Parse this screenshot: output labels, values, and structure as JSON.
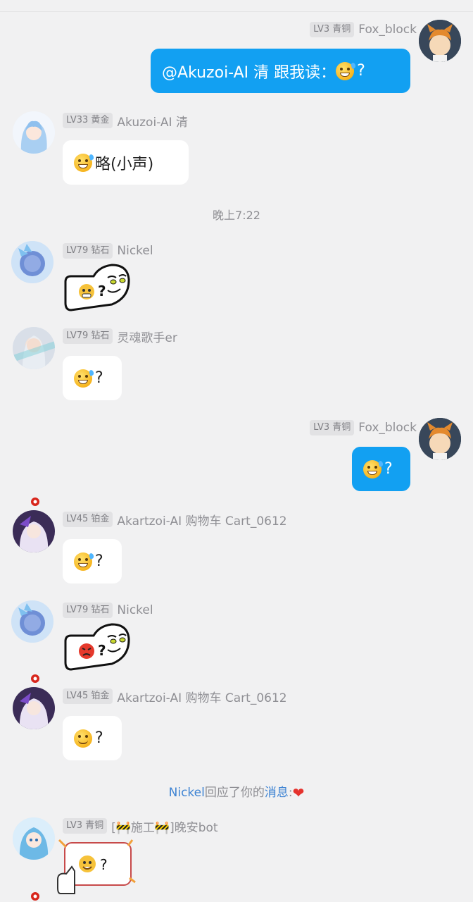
{
  "messages": [
    {
      "id": "m1",
      "side": "right",
      "level": "LV3 青铜",
      "name": "Fox_block",
      "text": "@Akuzoi-AI 清 跟我读：",
      "suffix": "?"
    },
    {
      "id": "m2",
      "side": "left",
      "level": "LV33 黄金",
      "name": "Akuzoi-AI 清",
      "text": "略(小声)"
    },
    {
      "id": "m3",
      "side": "left",
      "level": "LV79 钻石",
      "name": "Nickel",
      "sticker": "ghost-fear-question-sticker"
    },
    {
      "id": "m4",
      "side": "left",
      "level": "LV79 钻石",
      "name": "灵魂歌手er",
      "suffix": "?"
    },
    {
      "id": "m5",
      "side": "right",
      "level": "LV3 青铜",
      "name": "Fox_block",
      "suffix": "?"
    },
    {
      "id": "m6",
      "side": "left",
      "level": "LV45 铂金",
      "name": "Akartzoi-AI 购物车 Cart_0612",
      "suffix": "?"
    },
    {
      "id": "m7",
      "side": "left",
      "level": "LV79 钻石",
      "name": "Nickel",
      "sticker": "ghost-angry-question-sticker"
    },
    {
      "id": "m8",
      "side": "left",
      "level": "LV45 铂金",
      "name": "Akartzoi-AI 购物车 Cart_0612",
      "suffix": "?"
    },
    {
      "id": "m9",
      "side": "left",
      "level": "LV3 青铜",
      "name": "[🚧施工🚧]晚安bot",
      "sticker": "thumbs-laugh-question-sticker",
      "suffix": "?"
    }
  ],
  "timestamp": "晚上7:22",
  "notice": {
    "user": "Nickel",
    "mid": "回应了你的",
    "link": "消息",
    "colon": ":",
    "heart": "❤"
  },
  "colors": {
    "my_bubble": "#12a0f2",
    "other_bubble": "#ffffff",
    "background": "#f1f1f2",
    "link": "#3f84d3"
  }
}
